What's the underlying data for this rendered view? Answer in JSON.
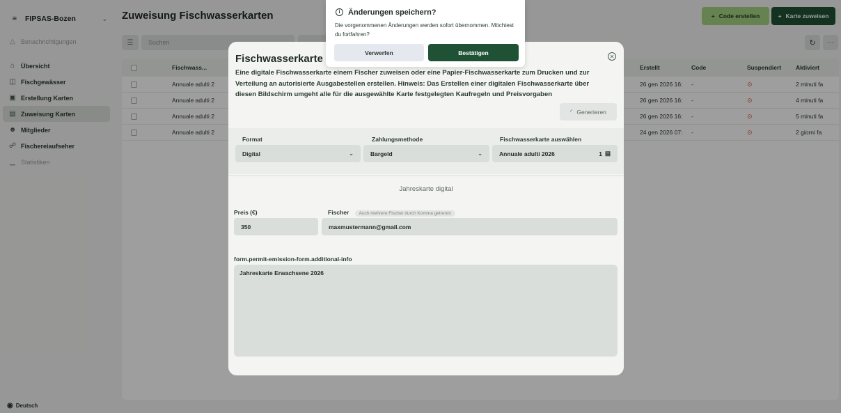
{
  "sidebar": {
    "org_name": "FIPSAS-Bozen",
    "notifications": "Benachrichtigungen",
    "items": [
      {
        "label": "Übersicht",
        "icon": "home-icon"
      },
      {
        "label": "Fischgewässer",
        "icon": "waters-icon"
      },
      {
        "label": "Erstellung Karten",
        "icon": "card-create-icon"
      },
      {
        "label": "Zuweisung Karten",
        "icon": "card-assign-icon",
        "active": true
      },
      {
        "label": "Mitglieder",
        "icon": "members-icon"
      },
      {
        "label": "Fischereiaufseher",
        "icon": "shield-icon"
      },
      {
        "label": "Statistiken",
        "icon": "chart-icon",
        "muted": true
      }
    ],
    "language": "Deutsch"
  },
  "header": {
    "title": "Zuweisung Fischwasserkarten",
    "code_button": "Code erstellen",
    "assign_button": "Karte zuweisen"
  },
  "toolbar": {
    "search_placeholder": "Suchen"
  },
  "table": {
    "columns": [
      "Fischwass...",
      "Erstellt",
      "Code",
      "Suspendiert",
      "Aktiviert"
    ],
    "rows": [
      {
        "name": "Annuale adulti 2",
        "created": "26 gen 2026 16:",
        "code": "-",
        "activated": "2 minuti fa"
      },
      {
        "name": "Annuale adulti 2",
        "created": "26 gen 2026 16:",
        "code": "-",
        "activated": "4 minuti fa"
      },
      {
        "name": "Annuale adulti 2",
        "created": "26 gen 2026 16:",
        "code": "-",
        "activated": "5 minuti fa"
      },
      {
        "name": "Annuale adulti 2",
        "created": "24 gen 2026 07:",
        "code": "-",
        "activated": "2 giorni fa"
      }
    ]
  },
  "dialog": {
    "title": "Fischwasserkarte zu",
    "description": "Eine digitale Fischwasserkarte einem Fischer zuweisen oder eine Papier-Fischwasserkarte zum Drucken und zur Verteilung an autorisierte Ausgabestellen erstellen. Hinweis: Das Erstellen einer digitalen Fischwasserkarte über diesen Bildschirm umgeht alle für die ausgewählte Karte festgelegten Kaufregeln und Preisvorgaben",
    "generate_button": "Generieren",
    "format_label": "Format",
    "format_value": "Digital",
    "payment_label": "Zahlungsmethode",
    "payment_value": "Bargeld",
    "card_label": "Fischwasserkarte auswählen",
    "card_value": "Annuale adulti 2026",
    "card_count": "1",
    "category": "Jahreskarte digital",
    "price_label": "Preis (€)",
    "price_value": "350",
    "fisher_label": "Fischer",
    "fisher_hint": "Auch mehrere Fischer durch Komma getrennt",
    "fisher_value": "maxmustermann@gmail.com",
    "info_label": "form.permit-emission-form.additional-info",
    "info_value": "Jahreskarte Erwachsene 2026"
  },
  "confirm": {
    "title": "Änderungen speichern?",
    "text": "Die vorgenommenen Änderungen werden sofort übernommen. Möchtest du fortfahren?",
    "cancel": "Verwerfen",
    "ok": "Bestätigen"
  },
  "colors": {
    "primary": "#1f5235",
    "secondary": "#a6d283",
    "danger": "#d9473d"
  }
}
